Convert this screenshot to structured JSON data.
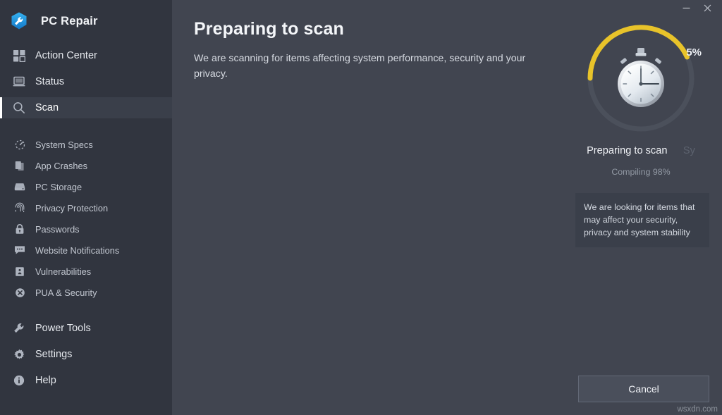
{
  "window": {
    "minimize_label": "Minimize",
    "close_label": "Close"
  },
  "brand": {
    "title": "PC Repair",
    "logo_icon": "wrench-shield-icon",
    "logo_color": "#2196e8"
  },
  "sidebar": {
    "primary_items": [
      {
        "label": "Action Center",
        "icon": "grid-icon",
        "active": false
      },
      {
        "label": "Status",
        "icon": "monitor-icon",
        "active": false
      },
      {
        "label": "Scan",
        "icon": "search-icon",
        "active": true
      }
    ],
    "sub_items": [
      {
        "label": "System Specs",
        "icon": "gauge-icon"
      },
      {
        "label": "App Crashes",
        "icon": "documents-icon"
      },
      {
        "label": "PC Storage",
        "icon": "drive-icon"
      },
      {
        "label": "Privacy Protection",
        "icon": "fingerprint-icon"
      },
      {
        "label": "Passwords",
        "icon": "lock-icon"
      },
      {
        "label": "Website Notifications",
        "icon": "chat-bubble-icon"
      },
      {
        "label": "Vulnerabilities",
        "icon": "shield-alert-icon"
      },
      {
        "label": "PUA & Security",
        "icon": "blocked-icon"
      }
    ],
    "tool_items": [
      {
        "label": "Power Tools",
        "icon": "wrench-icon"
      },
      {
        "label": "Settings",
        "icon": "gear-icon"
      },
      {
        "label": "Help",
        "icon": "info-icon"
      }
    ]
  },
  "main": {
    "title": "Preparing to scan",
    "subtitle": "We are scanning for items affecting system performance, security and your privacy."
  },
  "progress": {
    "percent_label": "5%",
    "percent_value": 5,
    "arc_color": "#e8c game",
    "track_color": "#4b505b",
    "status_current": "Preparing to scan",
    "status_next": "Sy",
    "status_sub": "Compiling 98%",
    "center_icon": "stopwatch-icon"
  },
  "tooltip": {
    "text": "We are looking for items that may affect your security, privacy and system stability"
  },
  "footer": {
    "cancel_label": "Cancel",
    "watermark": "wsxdn.com"
  }
}
